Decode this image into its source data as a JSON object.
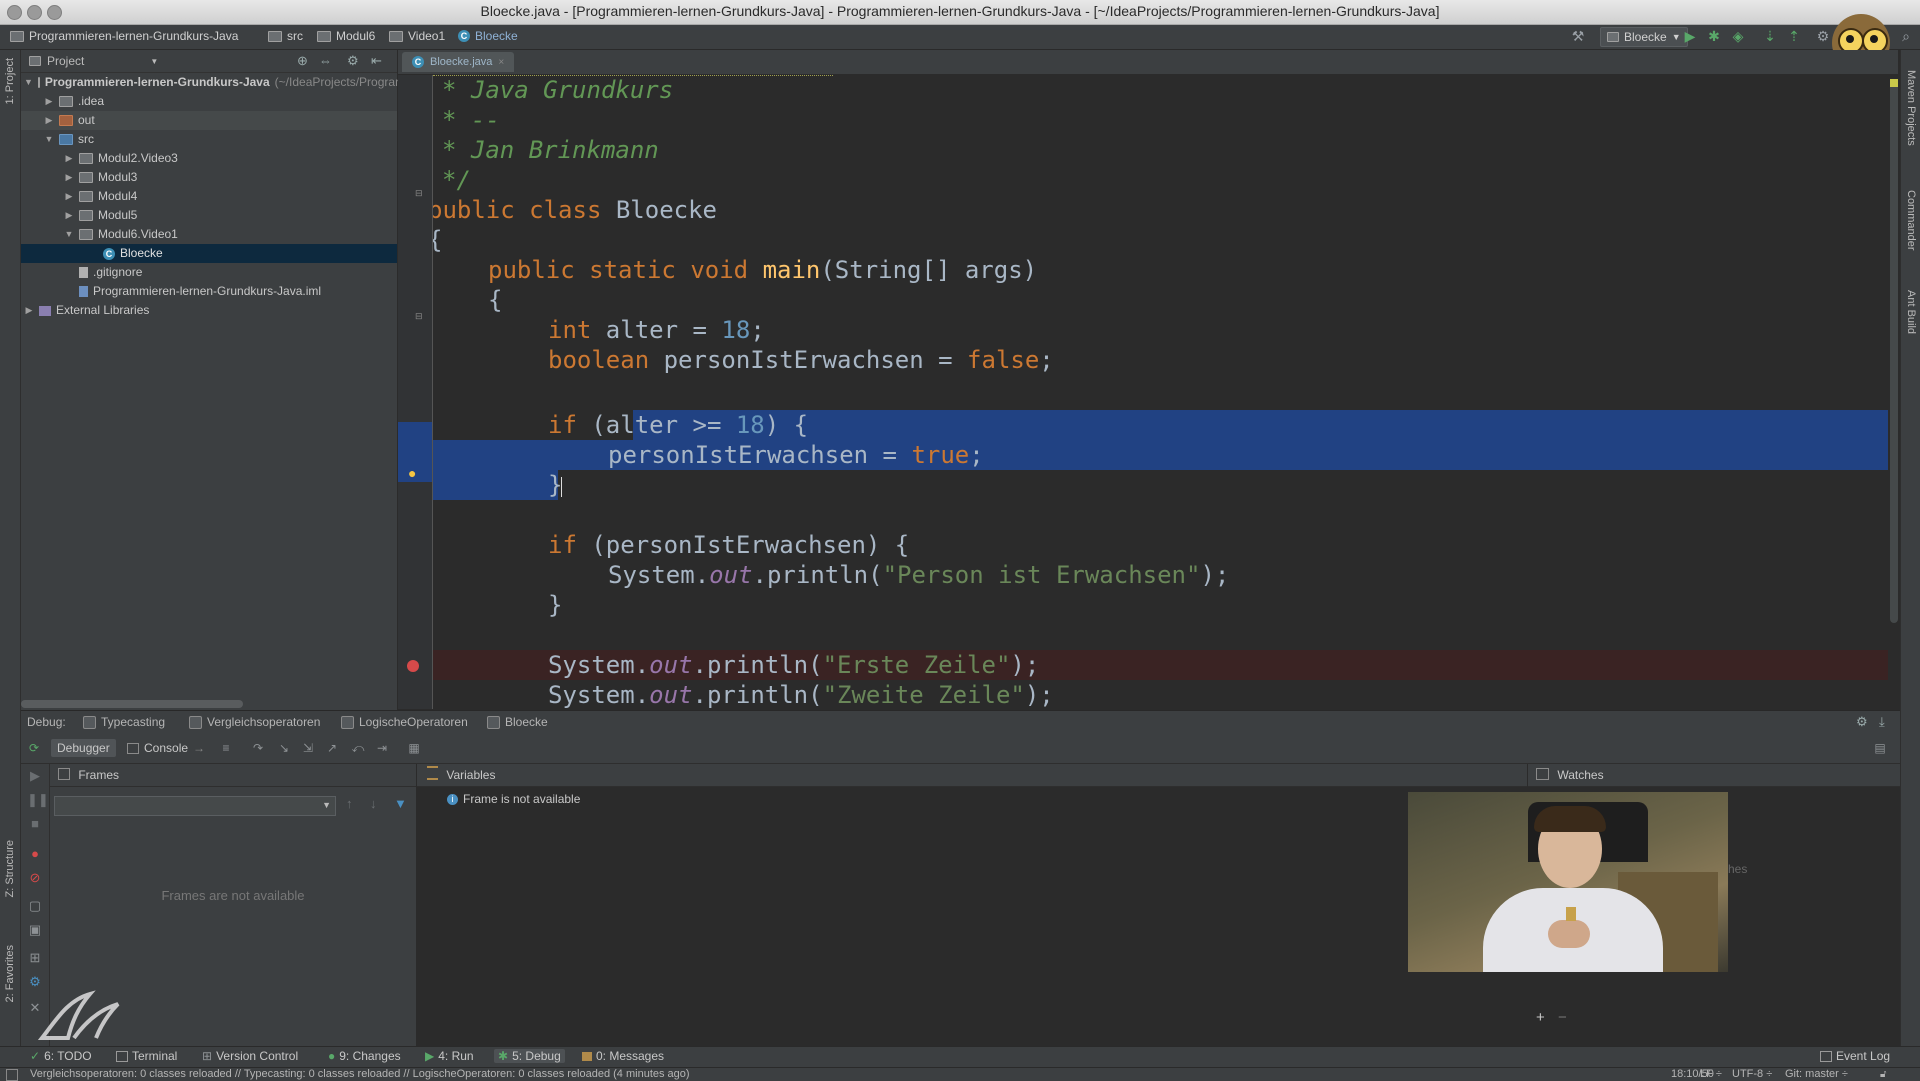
{
  "window": {
    "title": "Bloecke.java - [Programmieren-lernen-Grundkurs-Java] - Programmieren-lernen-Grundkurs-Java - [~/IdeaProjects/Programmieren-lernen-Grundkurs-Java]"
  },
  "navbar": {
    "crumbs": [
      "Programmieren-lernen-Grundkurs-Java",
      "src",
      "Modul6",
      "Video1",
      "Bloecke"
    ],
    "run_config": "Bloecke"
  },
  "left_stripe": {
    "project_label": "1: Project",
    "structure_label": "Z: Structure",
    "favorites_label": "2: Favorites"
  },
  "right_stripe": {
    "maven_label": "Maven Projects",
    "commander_label": "Commander",
    "ant_label": "Ant Build"
  },
  "project_panel": {
    "header": "Project",
    "tree": [
      {
        "label": "Programmieren-lernen-Grundkurs-Java",
        "suffix": "(~/IdeaProjects/Programmieren-lernen-Grundkurs-Java)"
      },
      {
        "label": ".idea"
      },
      {
        "label": "out"
      },
      {
        "label": "src"
      },
      {
        "label": "Modul2.Video3"
      },
      {
        "label": "Modul3"
      },
      {
        "label": "Modul4"
      },
      {
        "label": "Modul5"
      },
      {
        "label": "Modul6.Video1"
      },
      {
        "label": "Bloecke"
      },
      {
        "label": ".gitignore"
      },
      {
        "label": "Programmieren-lernen-Grundkurs-Java.iml"
      },
      {
        "label": "External Libraries"
      }
    ]
  },
  "editor": {
    "tab_label": "Bloecke.java",
    "lines": [
      "* Java Grundkurs",
      "* --",
      "* Jan Brinkmann",
      "*/",
      "public class Bloecke",
      "{",
      "public static void main(String[] args)",
      "{",
      "int alter = 18;",
      "boolean personIstErwachsen = false;",
      "",
      "if (alter >= 18) {",
      "personIstErwachsen = true;",
      "}",
      "",
      "if (personIstErwachsen) {",
      "System.out.println(\"Person ist Erwachsen\");",
      "}",
      "",
      "System.out.println(\"Erste Zeile\");",
      "System.out.println(\"Zweite Zeile\");"
    ]
  },
  "debug": {
    "label": "Debug:",
    "tabs": [
      "Typecasting",
      "Vergleichsoperatoren",
      "LogischeOperatoren",
      "Bloecke"
    ],
    "debugger_tab": "Debugger",
    "console_tab": "Console",
    "frames": {
      "title": "Frames",
      "empty": "Frames are not available"
    },
    "variables": {
      "title": "Variables",
      "message": "Frame is not available"
    },
    "watches": {
      "title": "Watches",
      "partial": "hes"
    }
  },
  "bottom_bar": {
    "tabs": [
      "6: TODO",
      "Terminal",
      "Version Control",
      "9: Changes",
      "4: Run",
      "5: Debug",
      "0: Messages"
    ],
    "event_log": "Event Log"
  },
  "status_bar": {
    "message": "Vergleichsoperatoren: 0 classes reloaded // Typecasting: 0 classes reloaded // LogischeOperatoren: 0 classes reloaded (4 minutes ago)",
    "position": "18:10/50",
    "line_sep": "LF ÷",
    "encoding": "UTF-8 ÷",
    "git": "Git: master ÷"
  },
  "colors": {
    "keyword": "#cc7832",
    "number": "#6897bb",
    "string": "#6a8759",
    "comment": "#629755",
    "selection": "#214283"
  }
}
